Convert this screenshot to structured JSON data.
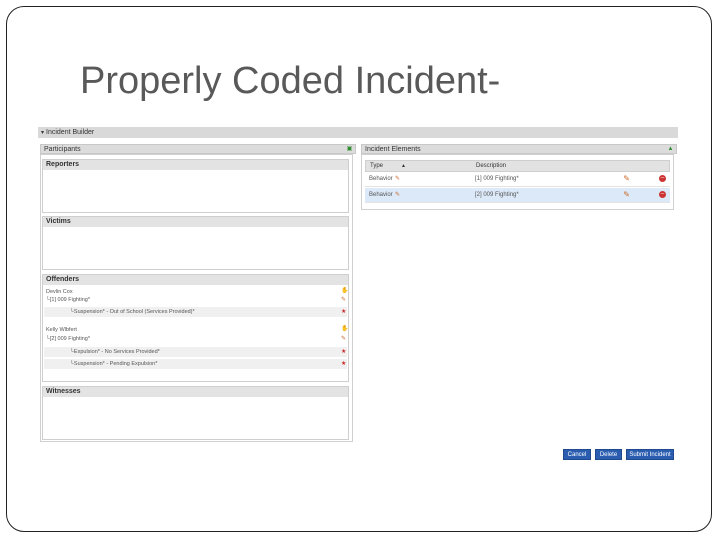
{
  "slide": {
    "title": "Properly Coded Incident-"
  },
  "builder": {
    "label": "Incident Builder"
  },
  "participants": {
    "label": "Participants",
    "sections": {
      "reporters": "Reporters",
      "victims": "Victims",
      "offenders": "Offenders",
      "witnesses": "Witnesses"
    },
    "offenders": [
      {
        "name": "Devlin Cox",
        "incident": "[1] 009 Fighting*",
        "actions": [
          "Suspension* - Out of School (Services Provided)*"
        ]
      },
      {
        "name": "Kelly Wlbfert",
        "incident": "[2] 009 Fighting*",
        "actions": [
          "Expulsion* - No Services Provided*",
          "Suspension* - Pending Expulsion*"
        ]
      }
    ]
  },
  "elements": {
    "label": "Incident Elements",
    "columns": {
      "type": "Type",
      "description": "Description"
    },
    "rows": [
      {
        "type": "Behavior",
        "description": "[1] 009 Fighting*"
      },
      {
        "type": "Behavior",
        "description": "[2] 009 Fighting*"
      }
    ]
  },
  "buttons": {
    "cancel": "Cancel",
    "delete": "Delete",
    "submit": "Submit Incident"
  },
  "icons": {
    "caret": "caret-down-icon",
    "add": "add-icon",
    "collapse": "collapse-icon",
    "thumb": "thumbs-up-icon",
    "edit": "edit-icon",
    "star": "action-star-icon",
    "delete": "delete-icon",
    "sort": "sort-asc-icon"
  },
  "colors": {
    "button": "#2a5db0",
    "header": "#dcdcdc",
    "title": "#595959",
    "delete": "#cc3333"
  }
}
